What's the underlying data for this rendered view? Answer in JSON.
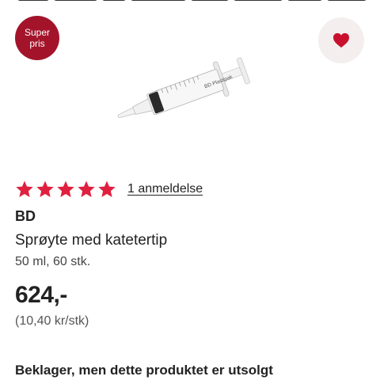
{
  "badge": {
    "line1": "Super",
    "line2": "pris",
    "color": "#a3142b"
  },
  "favorite": {
    "icon": "heart-icon",
    "color": "#c8102e"
  },
  "product": {
    "image_brand_text": "BD Plastipak",
    "rating_stars": 5,
    "rating_max": 5,
    "reviews_link": "1 anmeldelse",
    "brand": "BD",
    "name": "Sprøyte med katetertip",
    "variant": "50 ml, 60 stk.",
    "price": "624,-",
    "unit_price": "(10,40 kr/stk)",
    "availability": "Beklager, men dette produktet er utsolgt"
  },
  "colors": {
    "accent": "#e0203f",
    "badge": "#a3142b",
    "fav_bg": "#f4eeee"
  }
}
